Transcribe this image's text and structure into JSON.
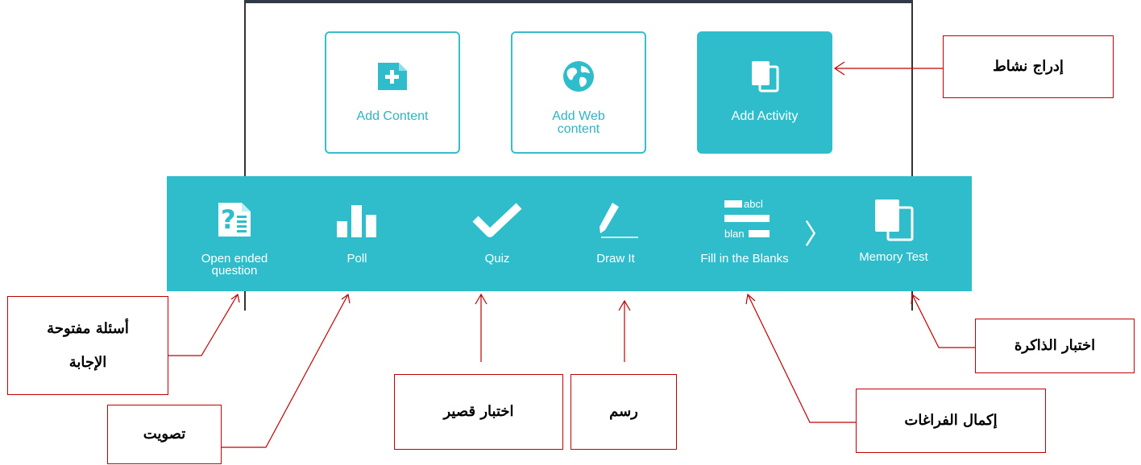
{
  "cards": [
    {
      "label": "Add Content",
      "icon": "add-document-icon",
      "active": false
    },
    {
      "label": "Add Web",
      "label_line2": "content",
      "icon": "globe-icon",
      "active": false
    },
    {
      "label": "Add Activity",
      "icon": "cards-icon",
      "active": true
    }
  ],
  "toolbar": {
    "items": [
      {
        "label": "Open ended",
        "label_line2": "question",
        "icon": "question-document-icon"
      },
      {
        "label": "Poll",
        "icon": "bar-chart-icon"
      },
      {
        "label": "Quiz",
        "icon": "checkmark-icon"
      },
      {
        "label": "Draw It",
        "icon": "pencil-icon"
      },
      {
        "label": "Fill in the Blanks",
        "icon": "fill-blanks-icon",
        "icon_text_top": "abcl",
        "icon_text_bottom": "blan"
      },
      {
        "label": "Memory Test",
        "icon": "cards-icon"
      }
    ],
    "next_icon": "chevron-right-icon",
    "next_glyph": "〉"
  },
  "callouts": {
    "insert_activity": "إدراج  نشاط",
    "open_questions_line1": "أسئلة مفتوحة",
    "open_questions_line2": "الإجابة",
    "poll": "تصويت",
    "short_quiz": "اختبار  قصير",
    "draw": "رسم",
    "fill_blanks": "إكمال الفراغات",
    "memory_test": "اختبار الذاكرة"
  },
  "colors": {
    "accent": "#2fbdcc",
    "callout_border": "#c00000",
    "arrow": "#c00000"
  }
}
